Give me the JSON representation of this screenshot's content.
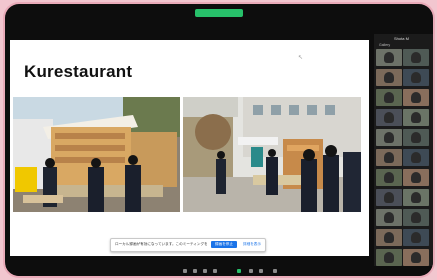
{
  "app": {
    "indicator_text": ""
  },
  "slide": {
    "title": "Kurestaurant",
    "notice": {
      "message": "ローカル録画が有効になっています。このミーティングを録画しています",
      "primary_label": "録画を停止",
      "secondary_label": "詳細を表示"
    }
  },
  "participants_panel": {
    "title": "Shota M",
    "subtitle": "Gallery",
    "tile_count": 22
  },
  "colors": {
    "page_bg": "#f2c6cf",
    "frame": "#0d0d0d",
    "accent_green": "#27c06a",
    "accent_blue": "#1a73e8"
  }
}
